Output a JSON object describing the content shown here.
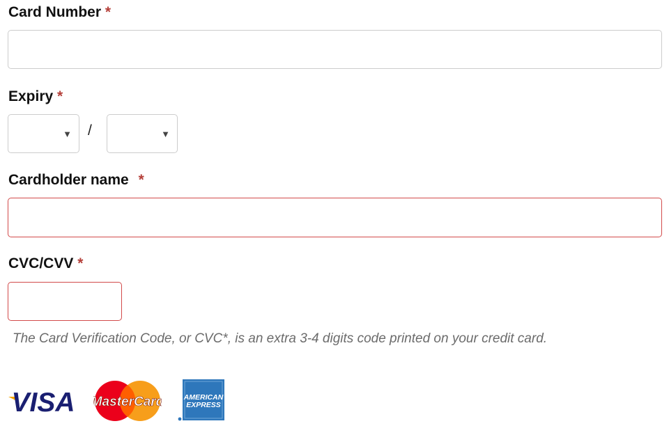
{
  "card_number": {
    "label": "Card Number",
    "required_mark": "*",
    "value": ""
  },
  "expiry": {
    "label": "Expiry",
    "required_mark": "*",
    "month_value": "",
    "year_value": "",
    "separator": "/",
    "caret_glyph": "▼"
  },
  "cardholder": {
    "label": "Cardholder name",
    "required_mark": "*",
    "value": "",
    "state": "error"
  },
  "cvc": {
    "label": "CVC/CVV",
    "required_mark": "*",
    "value": "",
    "state": "error",
    "help": "The Card Verification Code, or CVC*, is an extra 3-4 digits code printed on your credit card."
  },
  "logos": {
    "visa": "VISA",
    "mastercard": "MasterCard",
    "amex_line1": "AMERICAN",
    "amex_line2": "EXPRESS"
  },
  "colors": {
    "required": "#b5403a",
    "error_border": "#d24a4a",
    "default_border": "#cccccc",
    "help_text": "#6b6b6b",
    "visa_blue": "#1a1f71",
    "visa_gold": "#f7a600",
    "mc_red": "#eb001b",
    "mc_orange": "#f79e1b",
    "amex_blue": "#2e77bb"
  }
}
